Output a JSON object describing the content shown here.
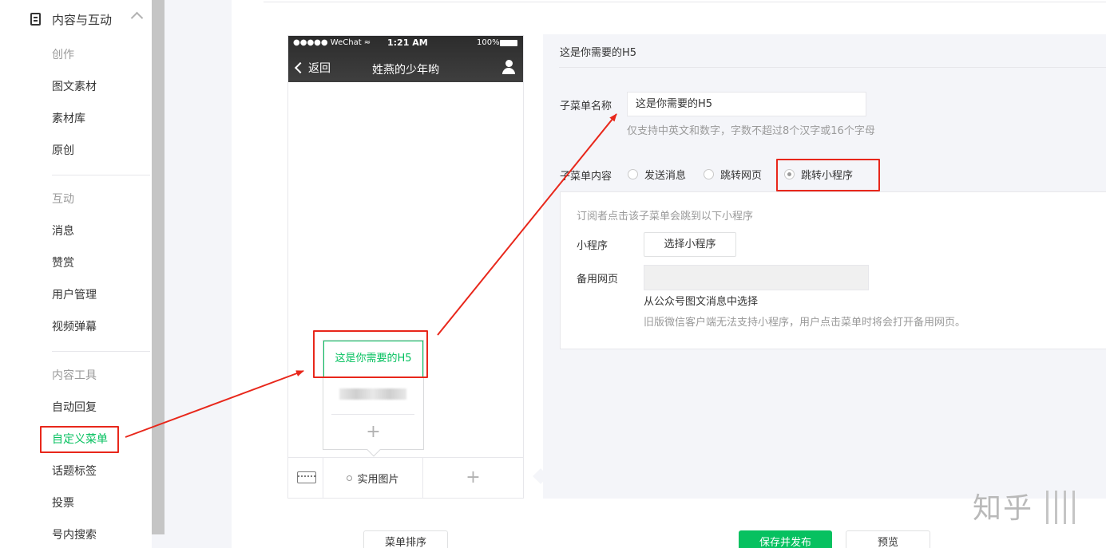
{
  "sidebar": {
    "section_title": "内容与互动",
    "icons": {
      "section": "document-icon",
      "collapse": "chevron-up-icon"
    },
    "groups": [
      {
        "label": "创作",
        "items": [
          "图文素材",
          "素材库",
          "原创"
        ]
      },
      {
        "label": "互动",
        "items": [
          "消息",
          "赞赏",
          "用户管理",
          "视频弹幕"
        ]
      },
      {
        "label": "内容工具",
        "items": [
          "自动回复",
          "自定义菜单",
          "话题标签",
          "投票",
          "号内搜索"
        ]
      }
    ],
    "active_item": "自定义菜单"
  },
  "phone": {
    "status": {
      "carrier": "●●●●● WeChat ≈",
      "time": "1:21 AM",
      "battery": "100%"
    },
    "back_label": "返回",
    "title": "姓燕的少年哟",
    "submenu_active": "这是你需要的H5",
    "menu_item_1": "实用图片",
    "plus": "+"
  },
  "editor": {
    "header": "这是你需要的H5",
    "name_label": "子菜单名称",
    "name_value": "这是你需要的H5",
    "name_hint": "仅支持中英文和数字，字数不超过8个汉字或16个字母",
    "content_label": "子菜单内容",
    "options": [
      "发送消息",
      "跳转网页",
      "跳转小程序"
    ],
    "selected_option": "跳转小程序",
    "mp_desc": "订阅者点击该子菜单会跳到以下小程序",
    "mp_label": "小程序",
    "mp_button": "选择小程序",
    "backup_label": "备用网页",
    "backup_link": "从公众号图文消息中选择",
    "backup_hint": "旧版微信客户端无法支持小程序，用户点击菜单时将会打开备用网页。"
  },
  "footer": {
    "sort_button": "菜单排序",
    "publish_button": "保存并发布",
    "preview_button": "预览"
  },
  "annotation_color": "#e8271b",
  "accent_color": "#07c160",
  "watermark": "知乎"
}
